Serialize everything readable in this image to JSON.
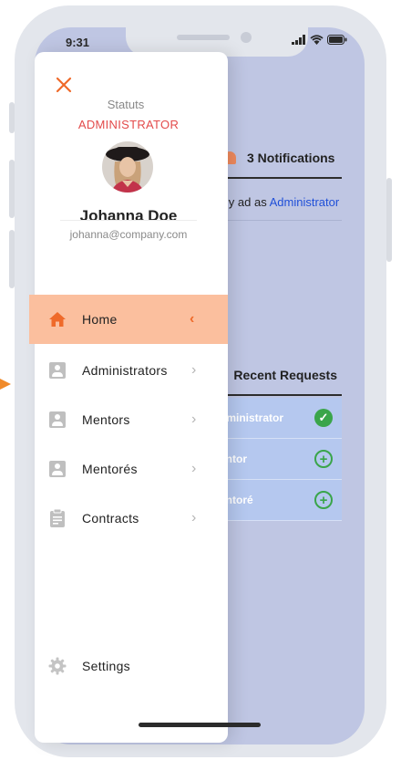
{
  "status_bar": {
    "time": "9:31"
  },
  "background": {
    "notifications_label": "3 Notifications",
    "logged_prefix": "lly ad as",
    "logged_role": "Administrator",
    "recent_title": "Recent Requests",
    "rows": [
      {
        "label": "dministrator",
        "icon": "check-circle-icon"
      },
      {
        "label": "entor",
        "icon": "plus-circle-icon"
      },
      {
        "label": "entoré",
        "icon": "plus-circle-icon"
      }
    ]
  },
  "drawer": {
    "statuts_label": "Statuts",
    "role": "ADMINISTRATOR",
    "user_name": "Johanna Doe",
    "user_email": "johanna@company.com",
    "menu": [
      {
        "label": "Home",
        "icon": "home-icon",
        "active": true
      },
      {
        "label": "Administrators",
        "icon": "person-icon"
      },
      {
        "label": "Mentors",
        "icon": "person-icon"
      },
      {
        "label": "Mentorés",
        "icon": "person-icon"
      },
      {
        "label": "Contracts",
        "icon": "clipboard-icon"
      }
    ],
    "settings_label": "Settings"
  },
  "colors": {
    "accent": "#ef6a2a",
    "active_bg": "#fbbf9e",
    "role_red": "#e34b4b",
    "overlay": "#bfc6e3",
    "success": "#3aa54a"
  }
}
